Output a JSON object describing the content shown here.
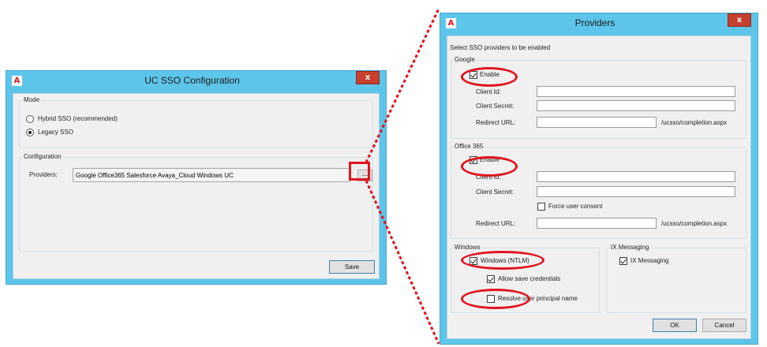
{
  "uc_window": {
    "title": "UC SSO Configuration",
    "icon_letter": "A",
    "close_label": "x",
    "mode": {
      "group_label": "Mode",
      "options": [
        {
          "label": "Hybrid SSO (recommended)",
          "selected": false
        },
        {
          "label": "Legacy SSO",
          "selected": true
        }
      ]
    },
    "configuration": {
      "group_label": "Configuration",
      "providers_label": "Providers:",
      "providers_value": "Google Office365 Salesforce Avaya_Cloud Windows UC",
      "browse_label": "..."
    },
    "save_label": "Save"
  },
  "providers_window": {
    "title": "Providers",
    "icon_letter": "A",
    "close_label": "x",
    "instruction": "Select SSO providers to be enabled",
    "google": {
      "group_label": "Google",
      "enable_label": "Enable",
      "enable_checked": true,
      "client_id_label": "Client Id:",
      "client_secret_label": "Client Secret:",
      "redirect_url_label": "Redirect URL:",
      "redirect_suffix": "/ucsso/completion.aspx"
    },
    "office365": {
      "group_label": "Office 365",
      "enable_label": "Enable",
      "enable_checked": true,
      "client_id_label": "Client Id:",
      "client_secret_label": "Client Secret:",
      "force_consent_label": "Force user consent",
      "force_consent_checked": false,
      "redirect_url_label": "Redirect URL:",
      "redirect_suffix": "/ucsso/completion.aspx"
    },
    "windows": {
      "group_label": "Windows",
      "ntlm_label": "Windows (NTLM)",
      "ntlm_checked": true,
      "allow_save_label": "Allow save credentials",
      "allow_save_checked": true,
      "resolve_upn_label": "Resolve user principal name",
      "resolve_upn_checked": false
    },
    "ix_messaging": {
      "group_label": "IX Messaging",
      "enable_label": "IX Messaging",
      "enable_checked": true
    },
    "ok_label": "OK",
    "cancel_label": "Cancel"
  },
  "colors": {
    "window_frame": "#5ec5ea",
    "annotation_red": "#e0141e",
    "close_button": "#c7402f"
  }
}
